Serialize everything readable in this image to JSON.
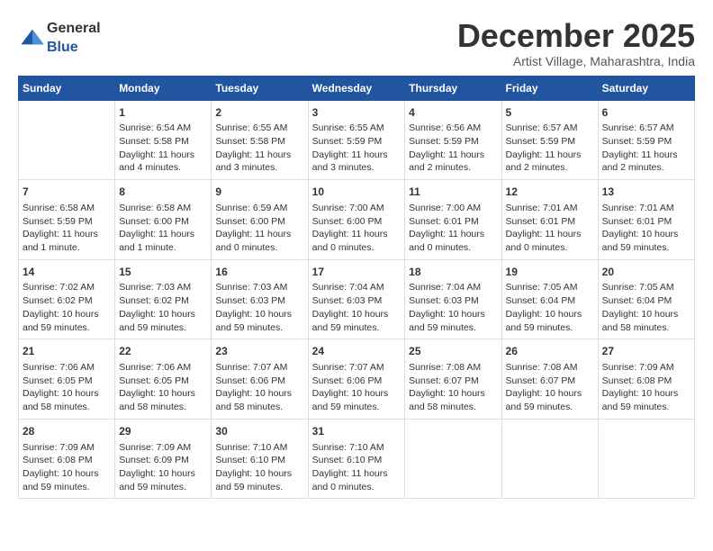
{
  "logo": {
    "general": "General",
    "blue": "Blue"
  },
  "header": {
    "month_title": "December 2025",
    "subtitle": "Artist Village, Maharashtra, India"
  },
  "calendar": {
    "days_of_week": [
      "Sunday",
      "Monday",
      "Tuesday",
      "Wednesday",
      "Thursday",
      "Friday",
      "Saturday"
    ],
    "weeks": [
      [
        {
          "day": "",
          "info": ""
        },
        {
          "day": "1",
          "info": "Sunrise: 6:54 AM\nSunset: 5:58 PM\nDaylight: 11 hours\nand 4 minutes."
        },
        {
          "day": "2",
          "info": "Sunrise: 6:55 AM\nSunset: 5:58 PM\nDaylight: 11 hours\nand 3 minutes."
        },
        {
          "day": "3",
          "info": "Sunrise: 6:55 AM\nSunset: 5:59 PM\nDaylight: 11 hours\nand 3 minutes."
        },
        {
          "day": "4",
          "info": "Sunrise: 6:56 AM\nSunset: 5:59 PM\nDaylight: 11 hours\nand 2 minutes."
        },
        {
          "day": "5",
          "info": "Sunrise: 6:57 AM\nSunset: 5:59 PM\nDaylight: 11 hours\nand 2 minutes."
        },
        {
          "day": "6",
          "info": "Sunrise: 6:57 AM\nSunset: 5:59 PM\nDaylight: 11 hours\nand 2 minutes."
        }
      ],
      [
        {
          "day": "7",
          "info": "Sunrise: 6:58 AM\nSunset: 5:59 PM\nDaylight: 11 hours\nand 1 minute."
        },
        {
          "day": "8",
          "info": "Sunrise: 6:58 AM\nSunset: 6:00 PM\nDaylight: 11 hours\nand 1 minute."
        },
        {
          "day": "9",
          "info": "Sunrise: 6:59 AM\nSunset: 6:00 PM\nDaylight: 11 hours\nand 0 minutes."
        },
        {
          "day": "10",
          "info": "Sunrise: 7:00 AM\nSunset: 6:00 PM\nDaylight: 11 hours\nand 0 minutes."
        },
        {
          "day": "11",
          "info": "Sunrise: 7:00 AM\nSunset: 6:01 PM\nDaylight: 11 hours\nand 0 minutes."
        },
        {
          "day": "12",
          "info": "Sunrise: 7:01 AM\nSunset: 6:01 PM\nDaylight: 11 hours\nand 0 minutes."
        },
        {
          "day": "13",
          "info": "Sunrise: 7:01 AM\nSunset: 6:01 PM\nDaylight: 10 hours\nand 59 minutes."
        }
      ],
      [
        {
          "day": "14",
          "info": "Sunrise: 7:02 AM\nSunset: 6:02 PM\nDaylight: 10 hours\nand 59 minutes."
        },
        {
          "day": "15",
          "info": "Sunrise: 7:03 AM\nSunset: 6:02 PM\nDaylight: 10 hours\nand 59 minutes."
        },
        {
          "day": "16",
          "info": "Sunrise: 7:03 AM\nSunset: 6:03 PM\nDaylight: 10 hours\nand 59 minutes."
        },
        {
          "day": "17",
          "info": "Sunrise: 7:04 AM\nSunset: 6:03 PM\nDaylight: 10 hours\nand 59 minutes."
        },
        {
          "day": "18",
          "info": "Sunrise: 7:04 AM\nSunset: 6:03 PM\nDaylight: 10 hours\nand 59 minutes."
        },
        {
          "day": "19",
          "info": "Sunrise: 7:05 AM\nSunset: 6:04 PM\nDaylight: 10 hours\nand 59 minutes."
        },
        {
          "day": "20",
          "info": "Sunrise: 7:05 AM\nSunset: 6:04 PM\nDaylight: 10 hours\nand 58 minutes."
        }
      ],
      [
        {
          "day": "21",
          "info": "Sunrise: 7:06 AM\nSunset: 6:05 PM\nDaylight: 10 hours\nand 58 minutes."
        },
        {
          "day": "22",
          "info": "Sunrise: 7:06 AM\nSunset: 6:05 PM\nDaylight: 10 hours\nand 58 minutes."
        },
        {
          "day": "23",
          "info": "Sunrise: 7:07 AM\nSunset: 6:06 PM\nDaylight: 10 hours\nand 58 minutes."
        },
        {
          "day": "24",
          "info": "Sunrise: 7:07 AM\nSunset: 6:06 PM\nDaylight: 10 hours\nand 59 minutes."
        },
        {
          "day": "25",
          "info": "Sunrise: 7:08 AM\nSunset: 6:07 PM\nDaylight: 10 hours\nand 58 minutes."
        },
        {
          "day": "26",
          "info": "Sunrise: 7:08 AM\nSunset: 6:07 PM\nDaylight: 10 hours\nand 59 minutes."
        },
        {
          "day": "27",
          "info": "Sunrise: 7:09 AM\nSunset: 6:08 PM\nDaylight: 10 hours\nand 59 minutes."
        }
      ],
      [
        {
          "day": "28",
          "info": "Sunrise: 7:09 AM\nSunset: 6:08 PM\nDaylight: 10 hours\nand 59 minutes."
        },
        {
          "day": "29",
          "info": "Sunrise: 7:09 AM\nSunset: 6:09 PM\nDaylight: 10 hours\nand 59 minutes."
        },
        {
          "day": "30",
          "info": "Sunrise: 7:10 AM\nSunset: 6:10 PM\nDaylight: 10 hours\nand 59 minutes."
        },
        {
          "day": "31",
          "info": "Sunrise: 7:10 AM\nSunset: 6:10 PM\nDaylight: 11 hours\nand 0 minutes."
        },
        {
          "day": "",
          "info": ""
        },
        {
          "day": "",
          "info": ""
        },
        {
          "day": "",
          "info": ""
        }
      ]
    ]
  }
}
